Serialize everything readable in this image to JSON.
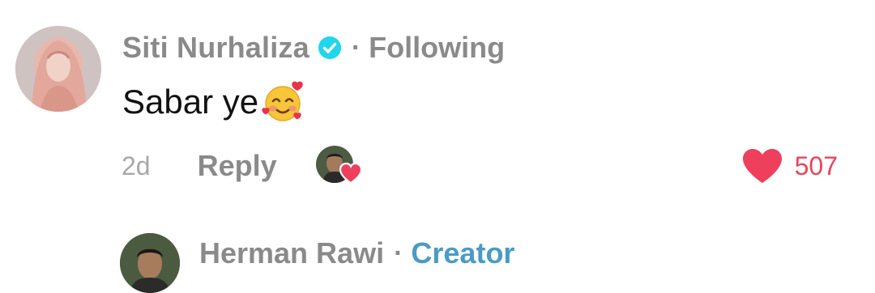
{
  "comment": {
    "username": "Siti Nurhaliza",
    "verified": true,
    "separator": "·",
    "follow_status": "Following",
    "text": "Sabar ye",
    "emoji": "smiling-face-with-hearts",
    "timestamp": "2d",
    "reply_label": "Reply",
    "creator_liked": true,
    "like_count": "507"
  },
  "reply_preview": {
    "username": "Herman Rawi",
    "separator": "·",
    "badge": "Creator"
  },
  "colors": {
    "muted_text": "#8a8a8a",
    "verified_blue": "#20d5ec",
    "like_red": "#e8455e",
    "creator_blue": "#4a9bc4"
  }
}
